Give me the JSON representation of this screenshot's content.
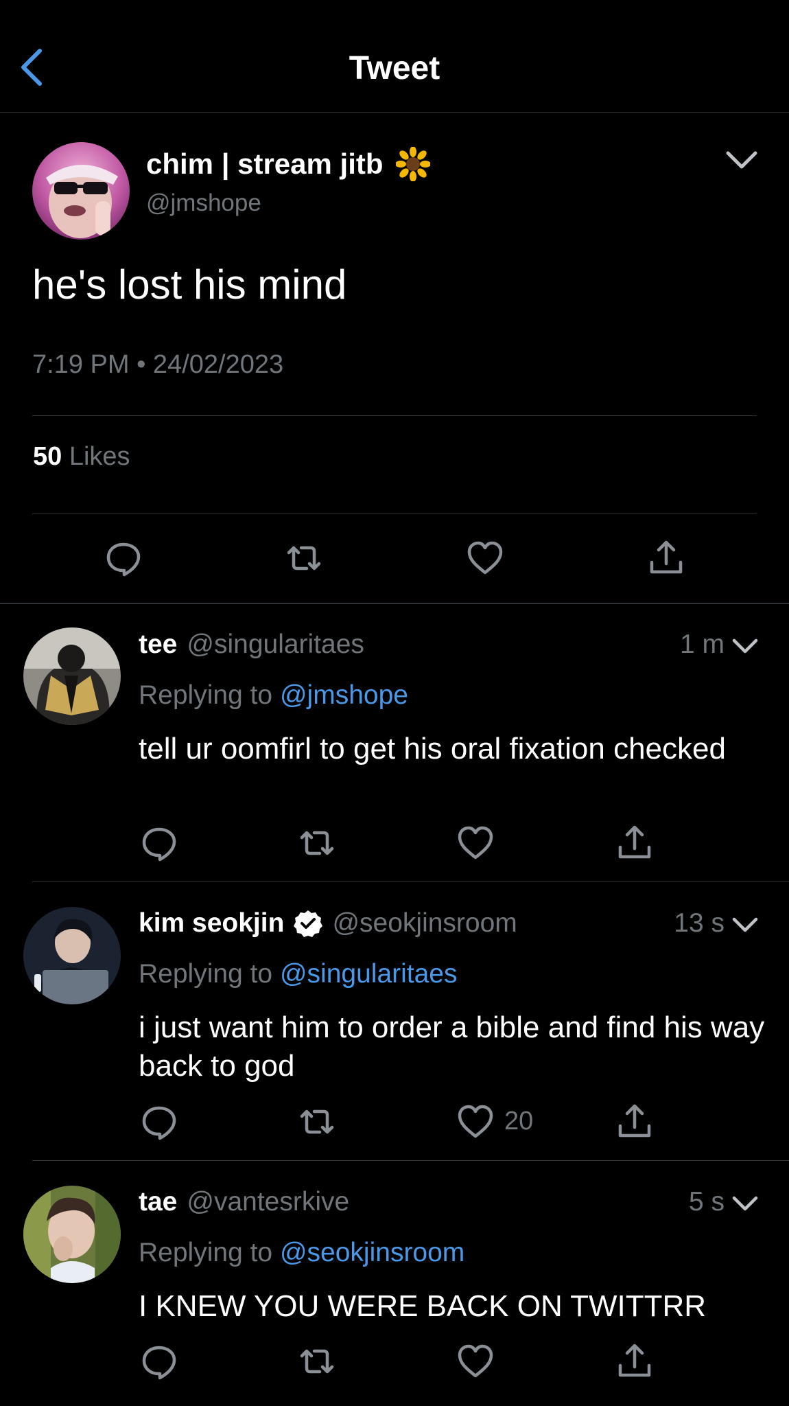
{
  "header": {
    "title": "Tweet"
  },
  "main_tweet": {
    "name": "chim | stream jitb",
    "handle": "@jmshope",
    "text": "he's lost his mind",
    "timestamp": "7:19 PM • 24/02/2023",
    "likes_count": "50",
    "likes_label": "Likes"
  },
  "replies": [
    {
      "name": "tee",
      "handle": "@singularitaes",
      "time": "1 m",
      "replying_label": "Replying to ",
      "replying_to": "@jmshope",
      "text": "tell ur oomfirl to get his oral fixation checked",
      "like_count": ""
    },
    {
      "name": "kim seokjin",
      "handle": "@seokjinsroom",
      "verified": true,
      "time": "13 s",
      "replying_label": "Replying to ",
      "replying_to": "@singularitaes",
      "text": "i just want him to order a bible and find his way back to god",
      "like_count": "20"
    },
    {
      "name": "tae",
      "handle": "@vantesrkive",
      "time": "5 s",
      "replying_label": "Replying to ",
      "replying_to": "@seokjinsroom",
      "text": "I KNEW YOU WERE BACK ON TWITTRR",
      "like_count": ""
    }
  ],
  "icons": {
    "back": "chevron-left-icon",
    "caret": "chevron-down-icon",
    "reply": "reply-icon",
    "retweet": "retweet-icon",
    "like": "heart-icon",
    "share": "share-icon",
    "sunflower": "sunflower-emoji"
  },
  "colors": {
    "background": "#000000",
    "accent": "#4a99e9",
    "muted": "#71767b",
    "divider": "#2f3336"
  }
}
